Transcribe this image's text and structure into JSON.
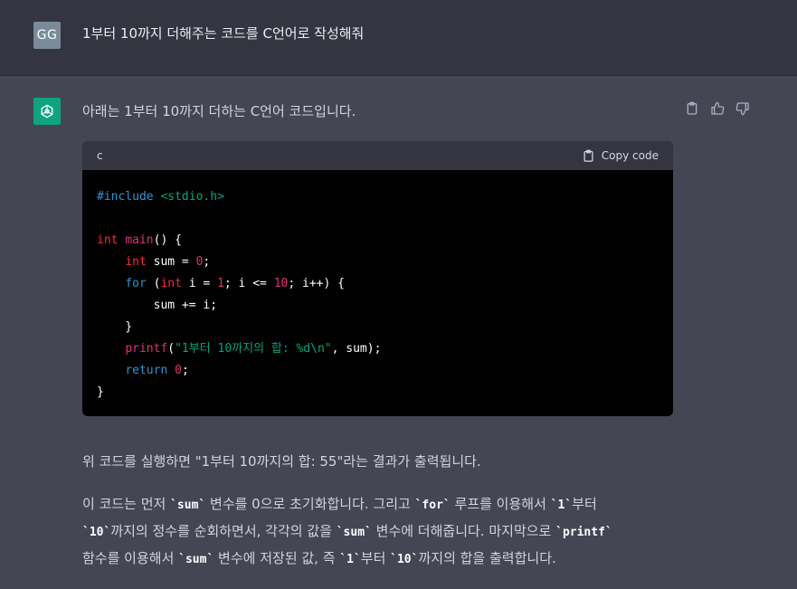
{
  "user": {
    "avatar_initials": "GG",
    "message": "1부터 10까지 더해주는 코드를 C언어로 작성해줘"
  },
  "assistant": {
    "intro": "아래는 1부터 10까지 더하는 C언어 코드입니다.",
    "code": {
      "language": "c",
      "copy_label": "Copy code",
      "lines": [
        [
          {
            "t": "#include ",
            "c": "pp"
          },
          {
            "t": "<stdio.h>",
            "c": "inc"
          }
        ],
        [],
        [
          {
            "t": "int",
            "c": "ty"
          },
          {
            "t": " ",
            "c": "plain"
          },
          {
            "t": "main",
            "c": "fn"
          },
          {
            "t": "() {",
            "c": "plain"
          }
        ],
        [
          {
            "t": "    ",
            "c": "plain"
          },
          {
            "t": "int",
            "c": "ty"
          },
          {
            "t": " sum = ",
            "c": "plain"
          },
          {
            "t": "0",
            "c": "num"
          },
          {
            "t": ";",
            "c": "plain"
          }
        ],
        [
          {
            "t": "    ",
            "c": "plain"
          },
          {
            "t": "for",
            "c": "kw"
          },
          {
            "t": " (",
            "c": "plain"
          },
          {
            "t": "int",
            "c": "ty"
          },
          {
            "t": " i = ",
            "c": "plain"
          },
          {
            "t": "1",
            "c": "num"
          },
          {
            "t": "; i <= ",
            "c": "plain"
          },
          {
            "t": "10",
            "c": "num"
          },
          {
            "t": "; i++) {",
            "c": "plain"
          }
        ],
        [
          {
            "t": "        sum += i;",
            "c": "plain"
          }
        ],
        [
          {
            "t": "    }",
            "c": "plain"
          }
        ],
        [
          {
            "t": "    ",
            "c": "plain"
          },
          {
            "t": "printf",
            "c": "fn"
          },
          {
            "t": "(",
            "c": "plain"
          },
          {
            "t": "\"1부터 10까지의 합: %d\\n\"",
            "c": "str"
          },
          {
            "t": ", sum);",
            "c": "plain"
          }
        ],
        [
          {
            "t": "    ",
            "c": "plain"
          },
          {
            "t": "return",
            "c": "kw"
          },
          {
            "t": " ",
            "c": "plain"
          },
          {
            "t": "0",
            "c": "num"
          },
          {
            "t": ";",
            "c": "plain"
          }
        ],
        [
          {
            "t": "}",
            "c": "plain"
          }
        ]
      ]
    },
    "result_text": "위 코드를 실행하면 \"1부터 10까지의 합: 55\"라는 결과가 출력됩니다.",
    "explanation": [
      {
        "t": "이 코드는 먼저 "
      },
      {
        "code": "`sum`"
      },
      {
        "t": " 변수를 0으로 초기화합니다. 그리고 "
      },
      {
        "code": "`for`"
      },
      {
        "t": " 루프를 이용해서 "
      },
      {
        "code": "`1`"
      },
      {
        "t": "부터 "
      },
      {
        "br": true
      },
      {
        "code": "`10`"
      },
      {
        "t": "까지의 정수를 순회하면서, 각각의 값을 "
      },
      {
        "code": "`sum`"
      },
      {
        "t": " 변수에 더해줍니다. 마지막으로 "
      },
      {
        "code": "`printf`"
      },
      {
        "br": true
      },
      {
        "t": "함수를 이용해서 "
      },
      {
        "code": "`sum`"
      },
      {
        "t": " 변수에 저장된 값, 즉 "
      },
      {
        "code": "`1`"
      },
      {
        "t": "부터 "
      },
      {
        "code": "`10`"
      },
      {
        "t": "까지의 합을 출력합니다."
      }
    ]
  },
  "colors": {
    "user_bg": "#343541",
    "assistant_bg": "#444654",
    "openai_green": "#10a37f",
    "user_avatar": "#7a8c99"
  }
}
